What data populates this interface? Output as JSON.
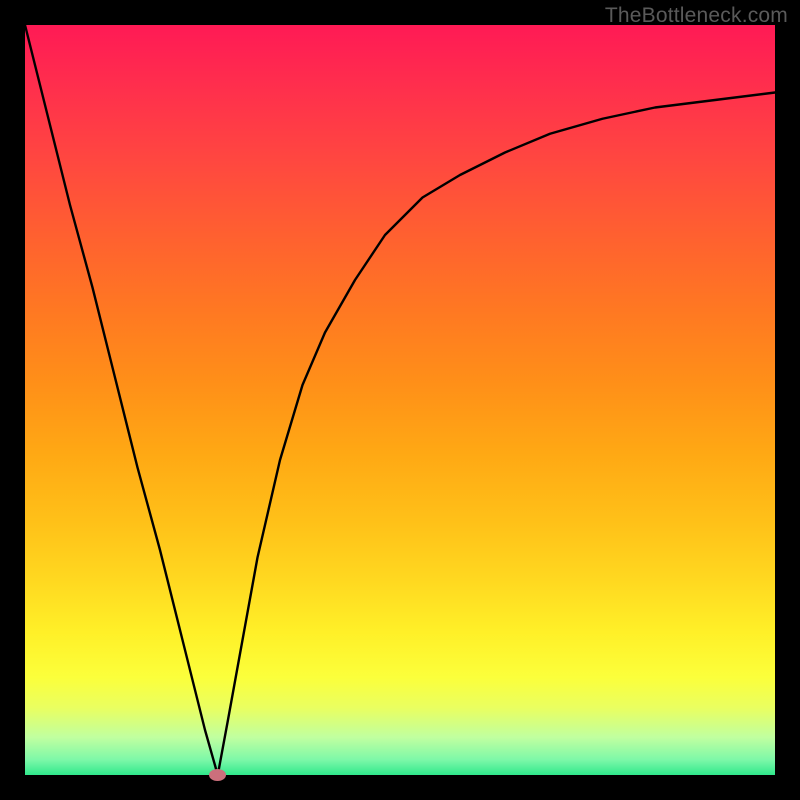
{
  "watermark": "TheBottleneck.com",
  "chart_data": {
    "type": "line",
    "title": "",
    "xlabel": "",
    "ylabel": "",
    "xlim": [
      0,
      100
    ],
    "ylim": [
      0,
      100
    ],
    "grid": false,
    "legend": false,
    "series": [
      {
        "name": "curve",
        "x": [
          0,
          3,
          6,
          9,
          12,
          15,
          18,
          21,
          24,
          25.7,
          27,
          29,
          31,
          34,
          37,
          40,
          44,
          48,
          53,
          58,
          64,
          70,
          77,
          84,
          92,
          100
        ],
        "values": [
          100,
          88,
          76,
          65,
          53,
          41,
          30,
          18,
          6,
          0,
          7,
          18,
          29,
          42,
          52,
          59,
          66,
          72,
          77,
          80,
          83,
          85.5,
          87.5,
          89,
          90,
          91
        ]
      }
    ],
    "annotations": {
      "marker": {
        "x": 25.7,
        "y": 0,
        "shape": "ellipse",
        "color": "#cc6f7c"
      }
    },
    "background": {
      "type": "vertical-gradient",
      "stops": [
        {
          "pos": 0,
          "color": "#ff1a55"
        },
        {
          "pos": 18,
          "color": "#ff4740"
        },
        {
          "pos": 38,
          "color": "#ff7822"
        },
        {
          "pos": 57,
          "color": "#ffa814"
        },
        {
          "pos": 74,
          "color": "#ffd820"
        },
        {
          "pos": 87,
          "color": "#fbff3b"
        },
        {
          "pos": 95,
          "color": "#c0ffa0"
        },
        {
          "pos": 100,
          "color": "#30e88c"
        }
      ]
    }
  }
}
